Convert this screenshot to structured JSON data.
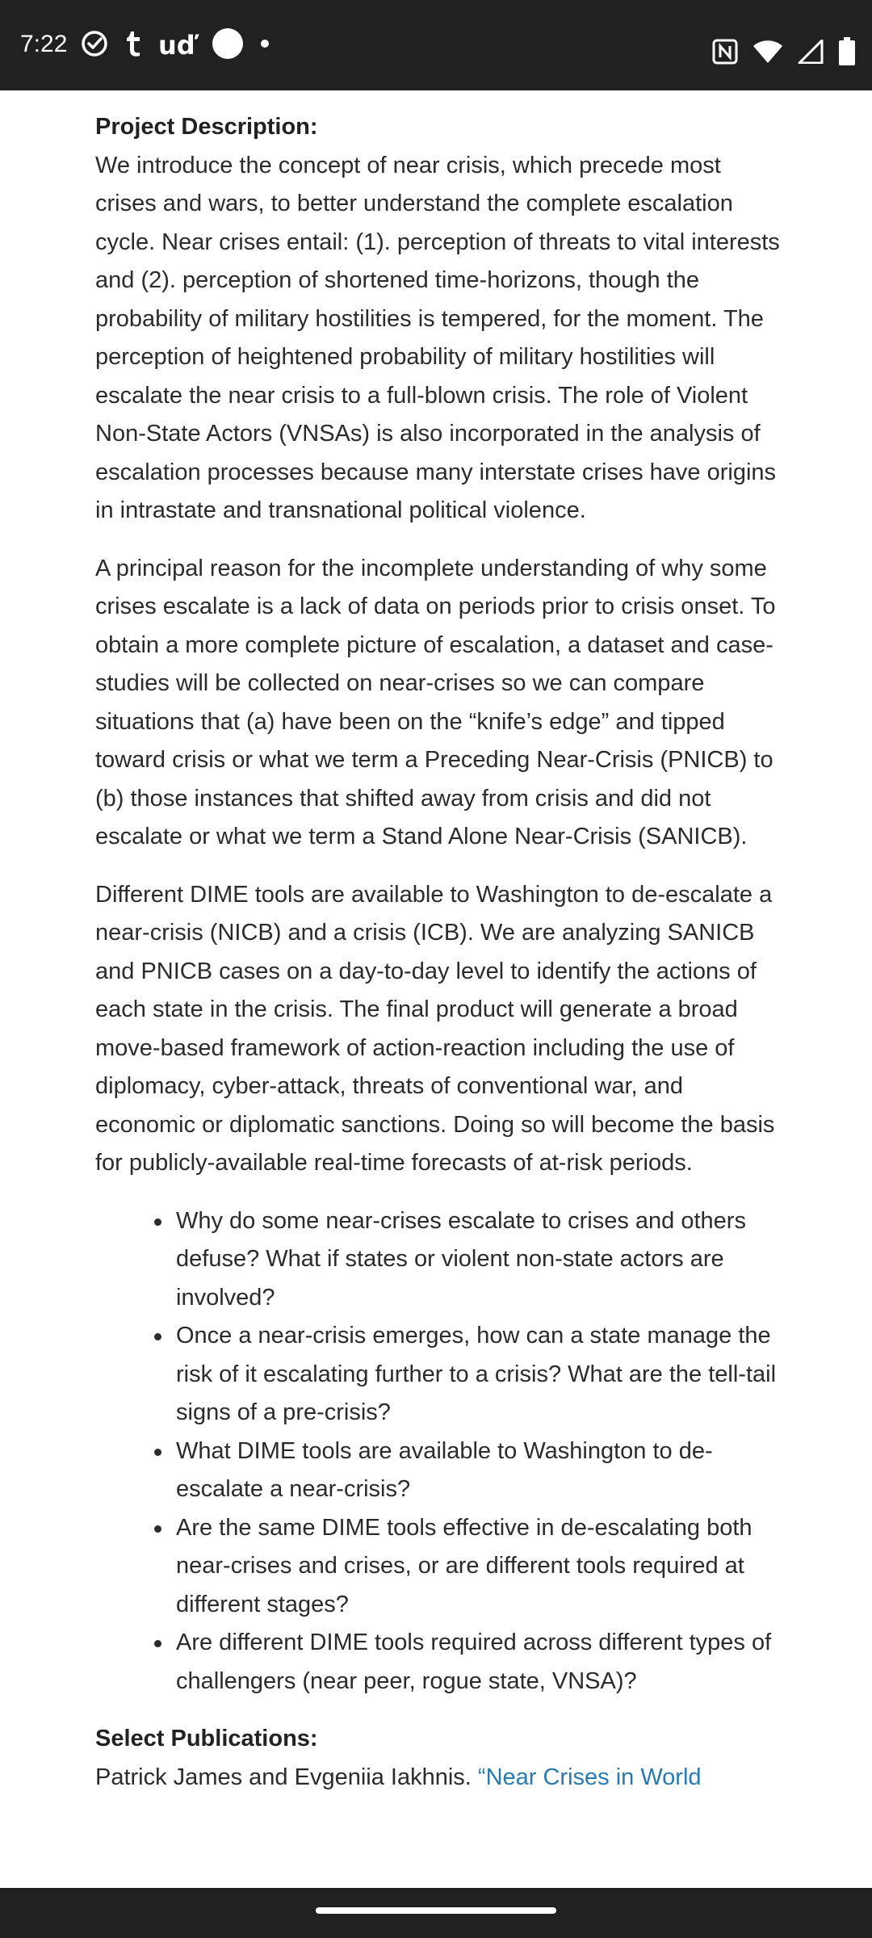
{
  "status_bar": {
    "time": "7:22",
    "left_icons": [
      "check-circle-icon",
      "tumblr-icon",
      "u-app-icon",
      "white-circle-icon",
      "dot-icon"
    ],
    "right_icons": [
      "nfc-icon",
      "wifi-icon",
      "cellular-signal-icon",
      "battery-icon"
    ],
    "u_glyph": "uď"
  },
  "article": {
    "project_heading": "Project Description:",
    "paragraphs": [
      "We introduce the concept of near crisis, which precede most crises and wars, to better understand the complete escalation cycle. Near crises entail: (1). perception of threats to vital interests and (2). perception of shortened time-horizons, though the probability of military hostilities is tempered, for the moment. The perception of heightened probability of military hostilities will escalate the near crisis to a full-blown crisis. The role of Violent Non-State Actors (VNSAs) is also incorporated in the analysis of escalation processes because many interstate crises have origins in intrastate and transnational political violence.",
      "A principal reason for the incomplete understanding of why some crises escalate is a lack of data on periods prior to crisis onset. To obtain a more complete picture of escalation, a dataset and case-studies will be collected on near-crises so we can compare situations that (a) have been on the “knife’s edge” and tipped toward crisis or what we term a Preceding Near-Crisis (PNICB) to (b) those instances that shifted away from crisis and did not escalate or what we term a Stand Alone Near-Crisis (SANICB).",
      "Different DIME tools are available to Washington to de-escalate a near-crisis (NICB) and a crisis (ICB). We are analyzing SANICB and PNICB cases on a day-to-day level to identify the actions of each state in the crisis. The final product will generate a broad move-based framework of action-reaction including the use of diplomacy, cyber-attack, threats of conventional war, and economic or diplomatic sanctions. Doing so will become the basis for publicly-available real-time forecasts of at-risk periods."
    ],
    "questions": [
      "Why do some near-crises escalate to crises and others defuse? What if states or violent non-state actors are involved?",
      "Once a near-crisis emerges, how can a state manage the risk of it escalating further to a crisis? What are the tell-tail signs of a pre-crisis?",
      "What DIME tools are available to Washington to de-escalate a near-crisis?",
      "Are the same DIME tools effective in de-escalating both near-crises and crises, or are different tools required at different stages?",
      "Are different DIME tools required across different types of challengers (near peer, rogue state, VNSA)?"
    ],
    "publications_heading": "Select Publications:",
    "publication_authors": "Patrick James and Evgeniia Iakhnis. ",
    "publication_link": "“Near Crises in World"
  },
  "colors": {
    "status_bar_bg": "#212121",
    "text": "#2b2b2b",
    "link": "#2a7ab0"
  }
}
